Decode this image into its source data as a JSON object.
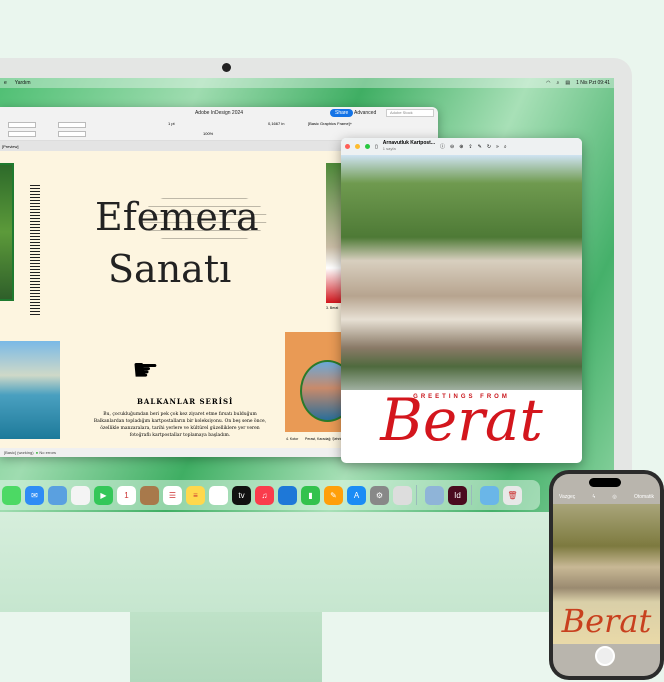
{
  "menubar": {
    "left": [
      "e",
      "Yardım"
    ],
    "datetime": "1 Nis Pzt 09:41"
  },
  "indesign": {
    "title": "Adobe InDesign 2024",
    "share": "Share",
    "workspace": "Advanced",
    "search_placeholder": "Adobe Stock",
    "stroke": "1 pt",
    "width_value": "0,1667 in",
    "zoom": "100%",
    "frame_style": "[Basic Graphics Frame]+",
    "tab": "[Preview]",
    "page": {
      "title_line1": "Efemera",
      "title_line2": "Sanatı",
      "series": "BALKANLAR SERİSİ",
      "body": "Bu, çocukluğumdan beri pek çok kez ziyaret etme fırsatı bulduğum Balkanlardan topladığım kartpostalların bir koleksiyonu. On beş sene önce, özellikle manzaralara, tarihi yerlere ve kültürel güzelliklere yer veren fotoğraflı kartpostallar toplamaya başladım.",
      "caption3": "3. Berat",
      "caption4": "4. Kotor",
      "caption4_text": "Perast, Karadağ; Şehrin aydan doğan..."
    },
    "status": {
      "style": "[Basic] (working)",
      "errors": "No errors"
    }
  },
  "preview": {
    "title": "Arnavutluk Kartpost...",
    "subtitle": "1 sayfa",
    "greeting": "GREETINGS FROM",
    "city": "Berat"
  },
  "dock": [
    "Messages",
    "Mail",
    "Maps",
    "Photos",
    "FaceTime",
    "Calendar",
    "Contacts",
    "Reminders",
    "Notes",
    "Freeform",
    "TV",
    "Music",
    "Keynote",
    "Numbers",
    "Pages",
    "App Store",
    "System Settings",
    "iPhone Mirroring",
    "Preview",
    "InDesign",
    "Downloads",
    "Trash"
  ],
  "calendar": {
    "month": "NIS",
    "day": "1"
  },
  "phone": {
    "cancel": "Vazgeç",
    "mode": "Otomatik",
    "city": "Berat"
  },
  "colors": {
    "accent": "#1473e6",
    "berat_red": "#d3161d",
    "page_bg": "#fdf5e0"
  }
}
